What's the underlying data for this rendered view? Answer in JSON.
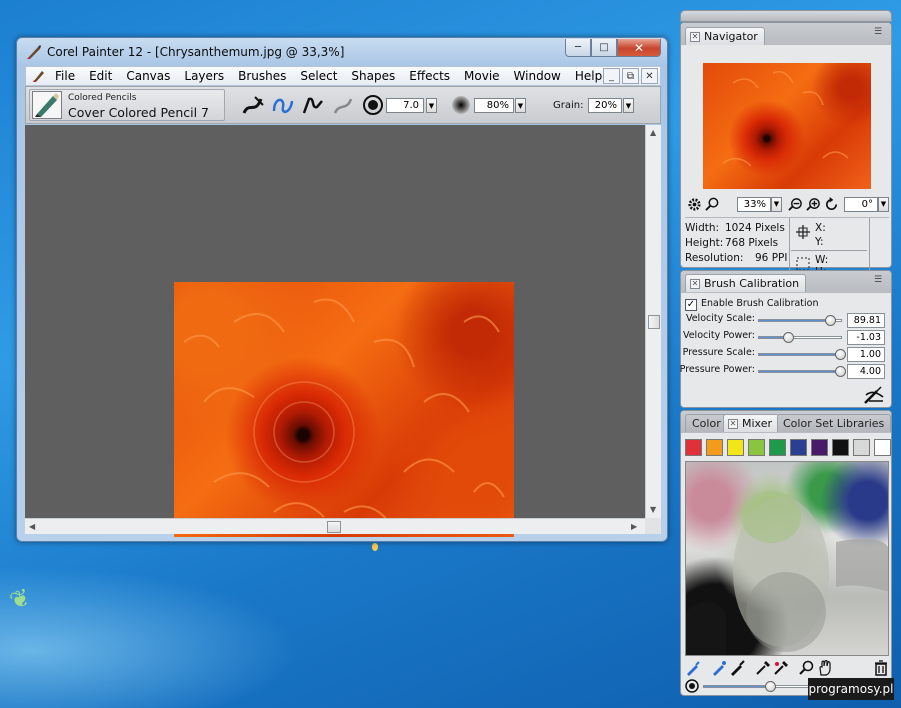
{
  "window": {
    "title": "Corel Painter 12 - [Chrysanthemum.jpg @ 33,3%]",
    "minimize": "─",
    "maximize": "□",
    "close": "✕"
  },
  "menu": {
    "items": [
      "File",
      "Edit",
      "Canvas",
      "Layers",
      "Brushes",
      "Select",
      "Shapes",
      "Effects",
      "Movie",
      "Window",
      "Help"
    ],
    "doc_minimize": "_",
    "doc_restore": "⧉",
    "doc_close": "✕"
  },
  "property_bar": {
    "brush_category": "Colored Pencils",
    "brush_variant": "Cover Colored Pencil 7",
    "size": "7.0",
    "opacity": "80%",
    "grain_label": "Grain:",
    "grain": "20%"
  },
  "navigator": {
    "tab": "Navigator",
    "zoom": "33%",
    "rotation": "0°",
    "width_label": "Width:",
    "width": "1024 Pixels",
    "height_label": "Height:",
    "height": "768 Pixels",
    "resolution_label": "Resolution:",
    "resolution": "96 PPI",
    "x_label": "X:",
    "y_label": "Y:",
    "w_label": "W:",
    "h_label": "H:"
  },
  "calibration": {
    "tab": "Brush Calibration",
    "enable_label": "Enable Brush Calibration",
    "enabled": true,
    "rows": [
      {
        "label": "Velocity Scale:",
        "value": "89.81",
        "level": 0.88
      },
      {
        "label": "Velocity Power:",
        "value": "-1.03",
        "level": 0.37
      },
      {
        "label": "Pressure Scale:",
        "value": "1.00",
        "level": 1.0
      },
      {
        "label": "Pressure Power:",
        "value": "4.00",
        "level": 1.0
      }
    ]
  },
  "color_panel": {
    "tabs": [
      "Color",
      "Mixer",
      "Color Set Libraries"
    ],
    "swatches": [
      "#e0303a",
      "#f39c1c",
      "#f2e61b",
      "#8bc43f",
      "#1f9a4a",
      "#2a3f8f",
      "#4a1a6a",
      "#111111",
      "#d8d8d8",
      "#ffffff"
    ],
    "mixer_brush_size_level": 0.45
  },
  "watermark": "programosy.pl"
}
